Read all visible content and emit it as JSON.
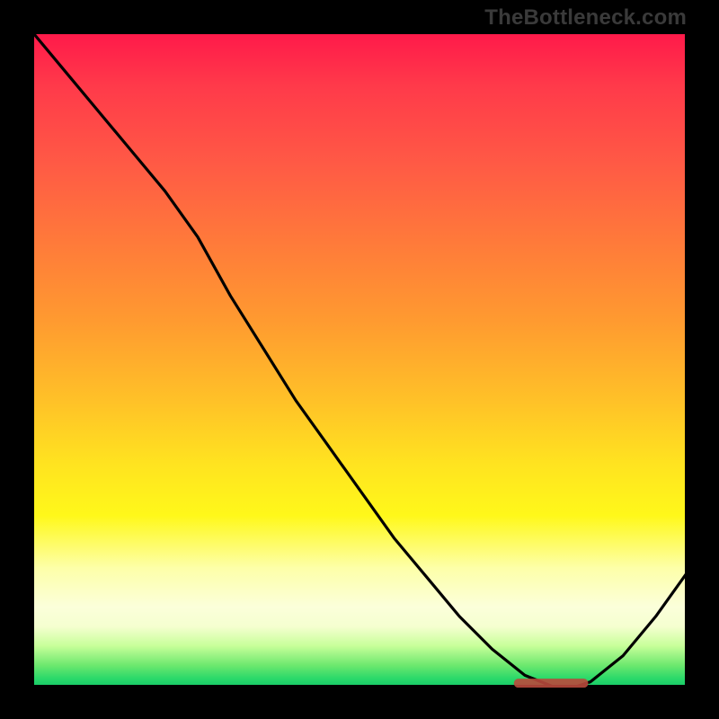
{
  "watermark": "TheBottleneck.com",
  "colors": {
    "background": "#000000",
    "curve": "#000000",
    "marker": "#b94a3c"
  },
  "chart_data": {
    "type": "line",
    "title": "",
    "xlabel": "",
    "ylabel": "",
    "xlim": [
      0,
      100
    ],
    "ylim": [
      0,
      100
    ],
    "grid": false,
    "legend": false,
    "note": "Values estimated from pixel positions; y represents height of the curve (0 = bottom/green, 100 = top/red).",
    "series": [
      {
        "name": "curve",
        "x": [
          0,
          5,
          10,
          15,
          20,
          25,
          30,
          35,
          40,
          45,
          50,
          55,
          60,
          65,
          70,
          75,
          80,
          82,
          85,
          90,
          95,
          100
        ],
        "y": [
          100,
          94,
          88,
          82,
          76,
          69,
          60,
          52,
          44,
          37,
          30,
          23,
          17,
          11,
          6,
          2,
          0,
          0,
          1,
          5,
          11,
          18
        ]
      }
    ],
    "marker": {
      "name": "highlighted-range",
      "x_start": 74,
      "x_end": 84,
      "y": 0.8
    },
    "gradient_stops": [
      {
        "pos": 0.0,
        "color": "#ff1a4a"
      },
      {
        "pos": 0.3,
        "color": "#ff7a3a"
      },
      {
        "pos": 0.6,
        "color": "#ffd024"
      },
      {
        "pos": 0.8,
        "color": "#fff81a"
      },
      {
        "pos": 0.92,
        "color": "#e8ffc0"
      },
      {
        "pos": 1.0,
        "color": "#1acd68"
      }
    ]
  }
}
